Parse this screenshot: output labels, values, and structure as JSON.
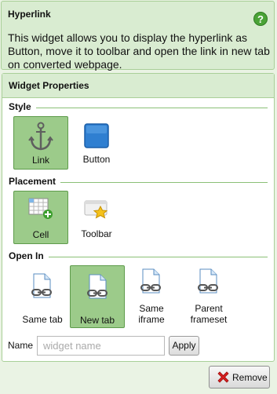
{
  "info": {
    "title": "Hyperlink",
    "help_glyph": "?",
    "description": "This widget allows you to display the hyperlink as Button, move it to toolbar and open the link in new tab on converted webpage."
  },
  "properties": {
    "header": "Widget Properties",
    "style": {
      "label": "Style",
      "options": [
        {
          "label": "Link",
          "icon": "anchor-icon",
          "selected": true
        },
        {
          "label": "Button",
          "icon": "blue-square-button-icon",
          "selected": false
        }
      ]
    },
    "placement": {
      "label": "Placement",
      "options": [
        {
          "label": "Cell",
          "icon": "grid-cell-add-icon",
          "selected": true
        },
        {
          "label": "Toolbar",
          "icon": "toolbar-star-icon",
          "selected": false
        }
      ]
    },
    "open_in": {
      "label": "Open In",
      "options": [
        {
          "label": "Same tab",
          "icon": "page-link-icon",
          "selected": false
        },
        {
          "label": "New tab",
          "icon": "page-link-icon",
          "selected": true
        },
        {
          "label_line1": "Same",
          "label_line2": "iframe",
          "icon": "page-link-icon",
          "selected": false
        },
        {
          "label_line1": "Parent",
          "label_line2": "frameset",
          "icon": "page-link-icon",
          "selected": false
        }
      ]
    },
    "name": {
      "label": "Name",
      "placeholder": "widget name",
      "value": "",
      "apply_label": "Apply"
    }
  },
  "footer": {
    "remove_label": "Remove"
  },
  "colors": {
    "background": "#eaf3e4",
    "header_green": "#d9ecd1",
    "border_green": "#a9cf98",
    "selected_green": "#9ccb8a",
    "remove_red": "#d71f1f"
  }
}
